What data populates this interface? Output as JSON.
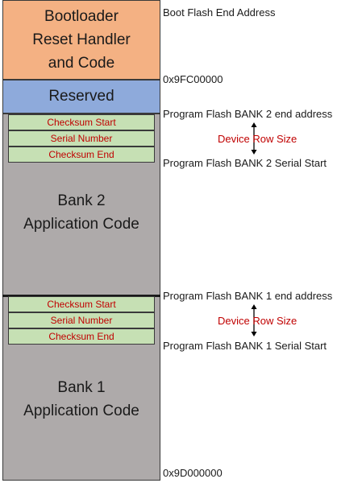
{
  "regions": {
    "boot": [
      "Bootloader",
      "Reset Handler",
      "and Code"
    ],
    "reserved": "Reserved",
    "bank2": [
      "Bank 2",
      "Application Code"
    ],
    "bank1": [
      "Bank 1",
      "Application Code"
    ]
  },
  "bank2_rows": [
    "Checksum Start",
    "Serial Number",
    "Checksum End"
  ],
  "bank1_rows": [
    "Checksum Start",
    "Serial Number",
    "Checksum End"
  ],
  "addresses": {
    "boot_flash_end": "Boot Flash End Address",
    "reserved_start": "0x9FC00000",
    "bank2_end": "Program Flash BANK 2 end address",
    "bank2_serial": "Program Flash BANK 2 Serial Start",
    "bank1_end": "Program Flash BANK 1 end address",
    "bank1_serial": "Program Flash BANK 1 Serial Start",
    "bank1_start": "0x9D000000"
  },
  "row_size_label": "Device Row Size",
  "colors": {
    "boot": "#f4b183",
    "reserved": "#8eaadb",
    "bank": "#aeaaaa",
    "row": "#c6e0b4",
    "row_text": "#c00000"
  }
}
